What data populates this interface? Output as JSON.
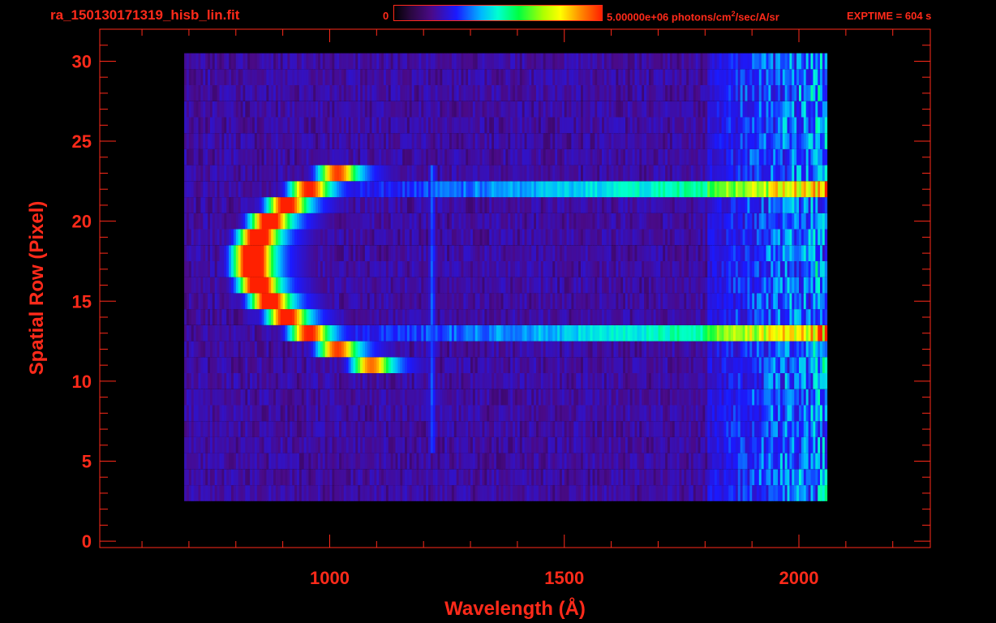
{
  "header": {
    "filename": "ra_150130171319_hisb_lin.fit",
    "colorbar_min_label": "0",
    "colorbar_max_label": "5.00000e+06 photons/cm",
    "colorbar_unit_superscript": "2",
    "colorbar_unit_tail": "/sec/A/sr",
    "exptime_label": "EXPTIME = 604 s"
  },
  "colors": {
    "text_axes": "#ff2a1a",
    "background": "#000000",
    "colormap": [
      "#000000",
      "#4a0a88",
      "#1a1aff",
      "#00b8ff",
      "#00ffd0",
      "#00ff40",
      "#ffff00",
      "#ff8800",
      "#ff2000"
    ]
  },
  "chart_data": {
    "type": "heatmap",
    "title": "ra_150130171319_hisb_lin.fit",
    "xlabel": "Wavelength (Å)",
    "ylabel": "Spatial Row (Pixel)",
    "xlim": [
      510,
      2280
    ],
    "ylim": [
      -0.4,
      32
    ],
    "x_ticks": [
      1000,
      1500,
      2000
    ],
    "y_ticks": [
      0,
      5,
      10,
      15,
      20,
      25,
      30
    ],
    "color_scale": {
      "min": 0,
      "max": 5000000,
      "units": "photons/cm^2/sec/A/sr",
      "scale": "linear"
    },
    "data_extent": {
      "x": [
        690,
        2085
      ],
      "rows": [
        3,
        30
      ]
    },
    "features": [
      {
        "name": "slit-image-peak",
        "x_range": [
          800,
          870
        ],
        "rows": [
          15,
          20
        ],
        "level": 0.95
      },
      {
        "name": "slit-image-shell",
        "x_range": [
          760,
          940
        ],
        "rows": [
          11,
          23
        ],
        "level": 0.55
      },
      {
        "name": "emission-line-1216",
        "x": 1216,
        "rows": [
          6,
          23
        ],
        "level": 0.35
      },
      {
        "name": "slit-edge-upper",
        "x_range": [
          1050,
          2060
        ],
        "row": 22,
        "level": 0.45
      },
      {
        "name": "slit-edge-lower",
        "x_range": [
          1050,
          2060
        ],
        "row": 13,
        "level": 0.45
      },
      {
        "name": "red-continuum",
        "x_range": [
          1900,
          2060
        ],
        "rows": [
          3,
          30
        ],
        "level": 0.45
      }
    ],
    "grid": false,
    "legend": "colorbar top"
  }
}
